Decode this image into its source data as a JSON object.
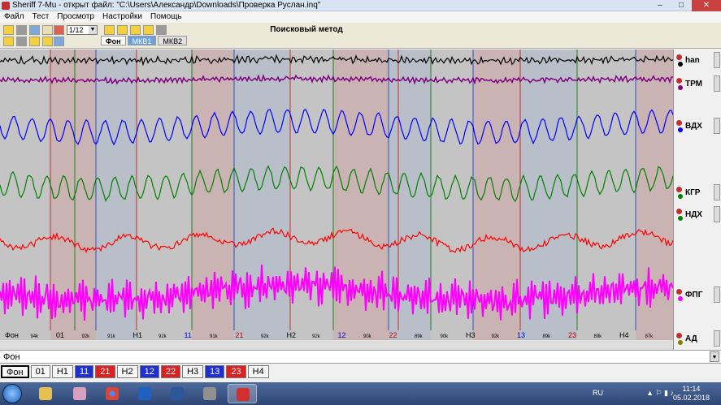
{
  "window": {
    "title": "Sheriff 7-Mu - открыт файл: \"C:\\Users\\Александр\\Downloads\\Проверка Руслан.inq\"",
    "controls": [
      "–",
      "□",
      "✕"
    ]
  },
  "menu": [
    "Файл",
    "Тест",
    "Просмотр",
    "Настройки",
    "Помощь"
  ],
  "toolbar": {
    "scale_value": "1/12",
    "method_title": "Поисковый метод",
    "tabs": [
      "Фон",
      "МКВ1",
      "МКВ2"
    ]
  },
  "channels": [
    {
      "name": "han",
      "color": "#000000"
    },
    {
      "name": "ТРМ",
      "color": "#800080"
    },
    {
      "name": "ВДХ",
      "color": "#0000ff"
    },
    {
      "name": "КГР",
      "color": "#008000"
    },
    {
      "name": "НДХ",
      "color": "#008000"
    },
    {
      "name": "ФПГ",
      "color": "#ff00ff"
    },
    {
      "name": "АД",
      "color": "#808000"
    }
  ],
  "timeline_labels": [
    "Фон",
    "94k",
    "01",
    "92k",
    "91k",
    "H1",
    "92k",
    "11",
    "91k",
    "21",
    "92k",
    "H2",
    "92k",
    "12",
    "90k",
    "22",
    "89k",
    "90k",
    "H3",
    "92k",
    "13",
    "89k",
    "23",
    "89k",
    "H4",
    "87k"
  ],
  "phase_select": {
    "label": "Фон"
  },
  "question_buttons": [
    {
      "label": "Фон",
      "style": "sel"
    },
    {
      "label": "01",
      "style": "plain"
    },
    {
      "label": "H1",
      "style": "plain"
    },
    {
      "label": "11",
      "style": "blue"
    },
    {
      "label": "21",
      "style": "red"
    },
    {
      "label": "H2",
      "style": "plain"
    },
    {
      "label": "12",
      "style": "blue"
    },
    {
      "label": "22",
      "style": "red"
    },
    {
      "label": "H3",
      "style": "plain"
    },
    {
      "label": "13",
      "style": "blue"
    },
    {
      "label": "23",
      "style": "red"
    },
    {
      "label": "H4",
      "style": "plain"
    }
  ],
  "taskbar": {
    "language": "RU",
    "time": "11:14",
    "date": "05.02.2018"
  }
}
